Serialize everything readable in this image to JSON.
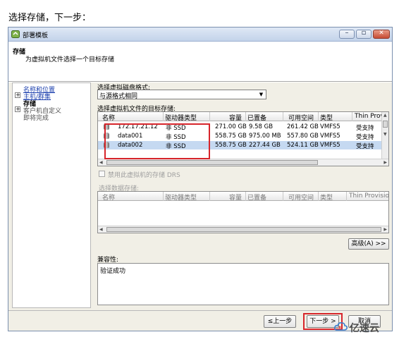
{
  "caption": "选择存储，下一步：",
  "window": {
    "title": "部署模板",
    "controls": {
      "minimize": "–",
      "maximize": "▫",
      "close": "✕"
    }
  },
  "header": {
    "title": "存储",
    "subtitle": "为虚拟机文件选择一个目标存储"
  },
  "nav": {
    "items": [
      {
        "label": "名称和位置",
        "link": true,
        "expander": false
      },
      {
        "label": "主机/群集",
        "link": true,
        "expander": true
      },
      {
        "label": "存储",
        "link": false,
        "expander": false,
        "current": true
      },
      {
        "label": "客户机自定义",
        "link": false,
        "expander": true
      },
      {
        "label": "即将完成",
        "link": false,
        "expander": false
      }
    ],
    "expander_symbol": "+"
  },
  "content": {
    "format_label": "选择虚拟磁盘格式:",
    "format_value": "与源格式相同",
    "target_label": "选择虚拟机文件的目标存储:",
    "columns": [
      "名称",
      "驱动器类型",
      "容量",
      "已置备",
      "可用空间",
      "类型",
      "Thin Prov"
    ],
    "rows": [
      [
        "172.17.21.12",
        "非 SSD",
        "271.00 GB",
        "9.58 GB",
        "261.42 GB",
        "VMFS5",
        "受支持"
      ],
      [
        "data001",
        "非 SSD",
        "558.75 GB",
        "975.00 MB",
        "557.80 GB",
        "VMFS5",
        "受支持"
      ],
      [
        "data002",
        "非 SSD",
        "558.75 GB",
        "227.44 GB",
        "524.11 GB",
        "VMFS5",
        "受支持"
      ]
    ],
    "selected_row": 2,
    "drs_label": "禁用此虚拟机的存储 DRS",
    "datastore_label": "选择数据存储:",
    "columns2": [
      "名称",
      "驱动器类型",
      "容量",
      "已置备",
      "可用空间",
      "类型",
      "Thin Provision"
    ],
    "advanced_button": "高级(A) >>",
    "compat_label": "兼容性:",
    "compat_text": "验证成功"
  },
  "footer": {
    "back": "≤上一步",
    "next": "下一步 >",
    "cancel": "取消"
  },
  "watermark": "亿速云",
  "colors": {
    "highlight": "#d7252b",
    "selected_row": "#c5d9f1",
    "link": "#1b3fae"
  }
}
